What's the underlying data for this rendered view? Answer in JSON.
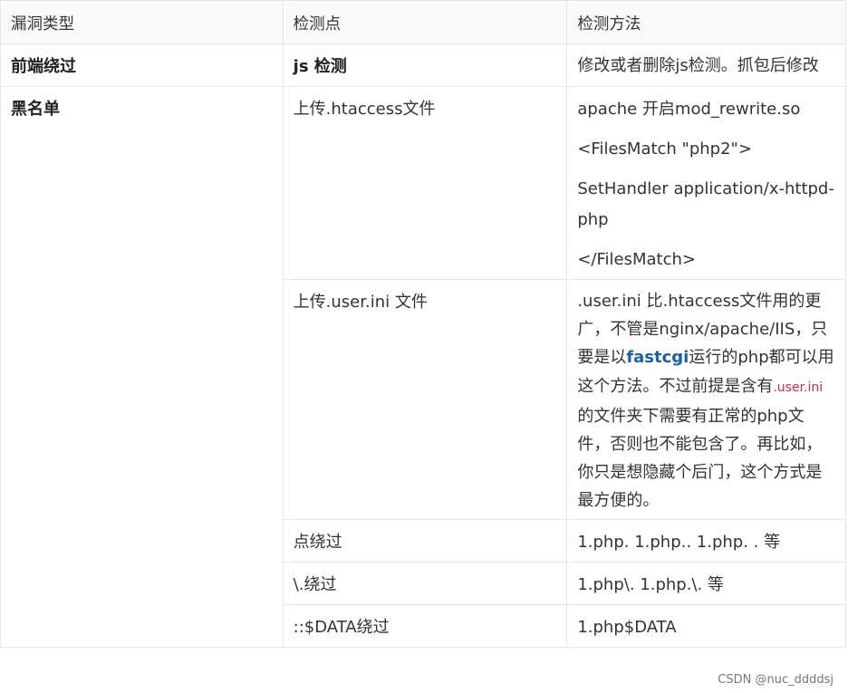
{
  "table": {
    "headers": [
      "漏洞类型",
      "检测点",
      "检测方法"
    ],
    "front": {
      "type": "前端绕过",
      "point": "js 检测",
      "method": "修改或者删除js检测。抓包后修改"
    },
    "blacklist": {
      "type": "黑名单",
      "rows": [
        {
          "point": "上传.htaccess文件",
          "method_lines": [
            "apache 开启mod_rewrite.so",
            "<FilesMatch \"php2\">",
            "SetHandler application/x-httpd-php",
            "</FilesMatch>"
          ]
        },
        {
          "point": "上传.user.ini 文件",
          "method_parts": [
            ".user.ini 比.htaccess文件用的更广，不管是nginx/apache/IIS，只要是以",
            "fastcgi",
            "运行的php都可以用这个方法。不过前提是含有",
            ".user.ini",
            "的文件夹下需要有正常的php文件，否则也不能包含了。再比如，你只是想隐藏个后门，这个方式是最方便的。"
          ]
        },
        {
          "point": "点绕过",
          "method": "1.php. 1.php.. 1.php. . 等"
        },
        {
          "point": "\\.绕过",
          "method": "1.php\\. 1.php.\\. 等"
        },
        {
          "point": "::$DATA绕过",
          "method": "1.php$DATA"
        }
      ]
    }
  },
  "watermark": "CSDN @nuc_ddddsj"
}
